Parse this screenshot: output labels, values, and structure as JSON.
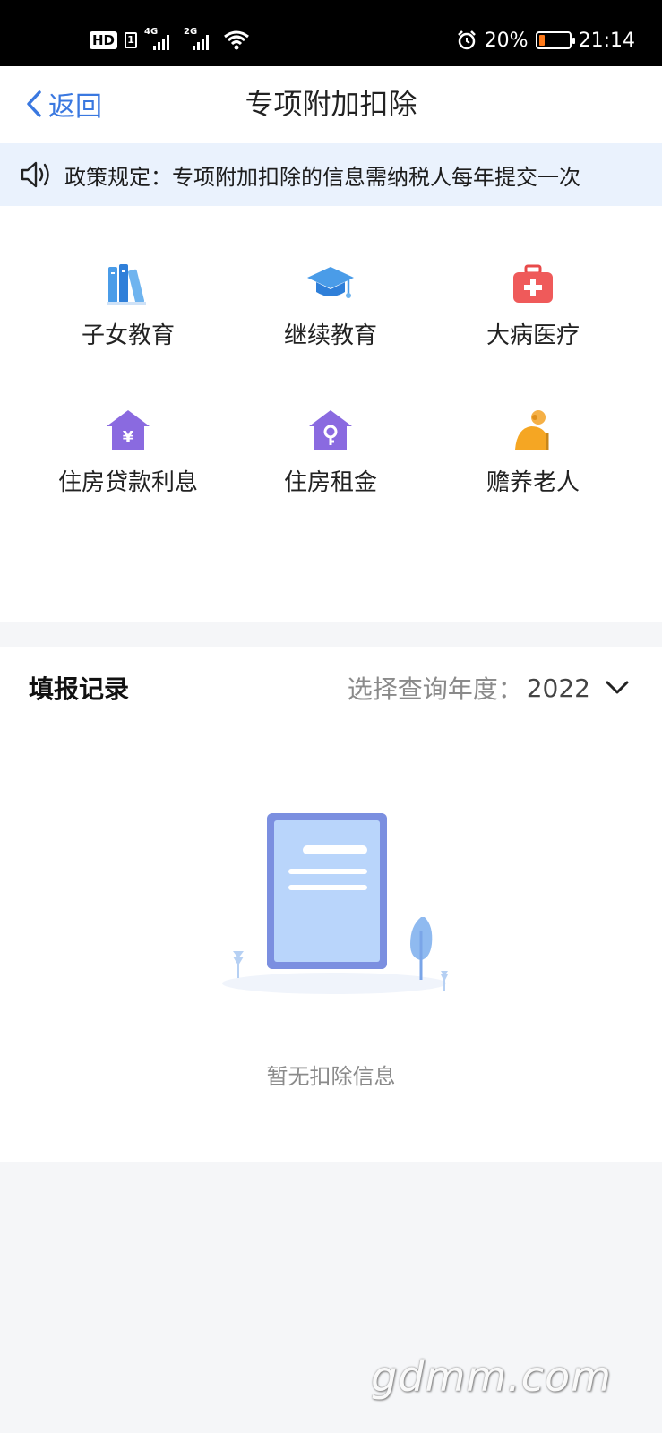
{
  "status_bar": {
    "hd": "HD",
    "sim": "1",
    "net1": "4G",
    "net2": "2G",
    "battery_percent": "20%",
    "battery_level": 0.2,
    "time": "21:14"
  },
  "nav": {
    "back_label": "返回",
    "title": "专项附加扣除"
  },
  "notice": {
    "text": "政策规定：专项附加扣除的信息需纳税人每年提交一次"
  },
  "categories": [
    {
      "label": "子女教育",
      "icon": "books-icon"
    },
    {
      "label": "继续教育",
      "icon": "graduation-cap-icon"
    },
    {
      "label": "大病医疗",
      "icon": "medical-kit-icon"
    },
    {
      "label": "住房贷款利息",
      "icon": "house-loan-icon"
    },
    {
      "label": "住房租金",
      "icon": "house-key-icon"
    },
    {
      "label": "赡养老人",
      "icon": "elderly-icon"
    }
  ],
  "records": {
    "title": "填报记录",
    "year_label": "选择查询年度：",
    "year_value": "2022",
    "empty_text": "暂无扣除信息"
  },
  "watermark": "gdmm.com",
  "colors": {
    "accent": "#3a78e0",
    "notice_bg": "#eaf2fd",
    "battery": "#ff7a1a"
  }
}
